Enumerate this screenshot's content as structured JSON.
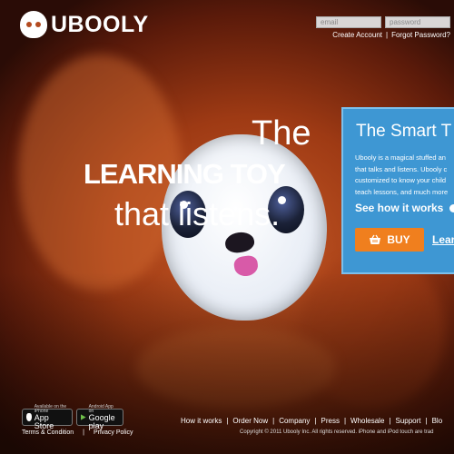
{
  "brand": {
    "name": "UBOOLY"
  },
  "login": {
    "email_placeholder": "email",
    "password_placeholder": "password",
    "create_account": "Create Account",
    "forgot_password": "Forgot Password?",
    "separator": "|"
  },
  "hero": {
    "line1": "The",
    "line2": "LEARNING TOY",
    "line3": "that listens."
  },
  "panel": {
    "title": "The Smart T",
    "body_lines": [
      "Ubooly is a magical stuffed an",
      "that talks and listens. Ubooly c",
      "customized to know your child",
      "teach lessons, and much more"
    ],
    "see_how": "See how it works",
    "buy_label": "BUY",
    "learn_label": "Learn"
  },
  "footer": {
    "app_store_small": "Available on the iPhone",
    "app_store_big": "App Store",
    "google_play_small": "Android App on",
    "google_play_big": "Google play",
    "terms": "Terms & Condition",
    "privacy": "Privacy Policy",
    "nav": [
      "How it works",
      "Order Now",
      "Company",
      "Press",
      "Wholesale",
      "Support",
      "Blo"
    ],
    "separator": "|",
    "copyright": "Copyright © 2011 Ubooly Inc. All rights reserved. iPhone and iPod touch are trad"
  },
  "colors": {
    "panel_blue": "#3e97d3",
    "buy_orange": "#f07f1e"
  }
}
